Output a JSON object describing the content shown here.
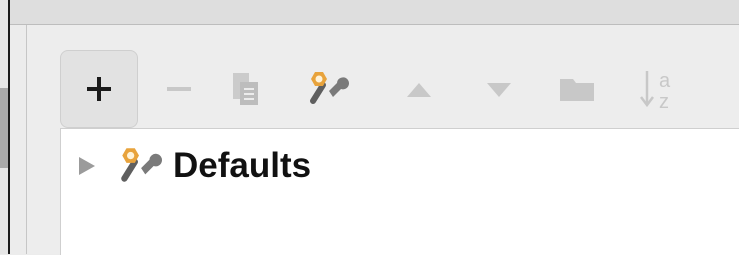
{
  "tree": {
    "items": [
      {
        "label": "Defaults",
        "expanded": false
      }
    ]
  },
  "colors": {
    "enabled_icon": "#1a1a1a",
    "disabled_icon": "#c8c8c8",
    "settings_icon_orange": "#e8a33c"
  },
  "icons": {
    "add": "plus-icon",
    "remove": "minus-icon",
    "copy": "copy-icon",
    "edit_defaults": "wrench-icon",
    "move_up": "triangle-up-icon",
    "move_down": "triangle-down-icon",
    "folder": "folder-icon",
    "sort": "sort-alpha-icon",
    "expand": "expand-arrow-icon"
  }
}
